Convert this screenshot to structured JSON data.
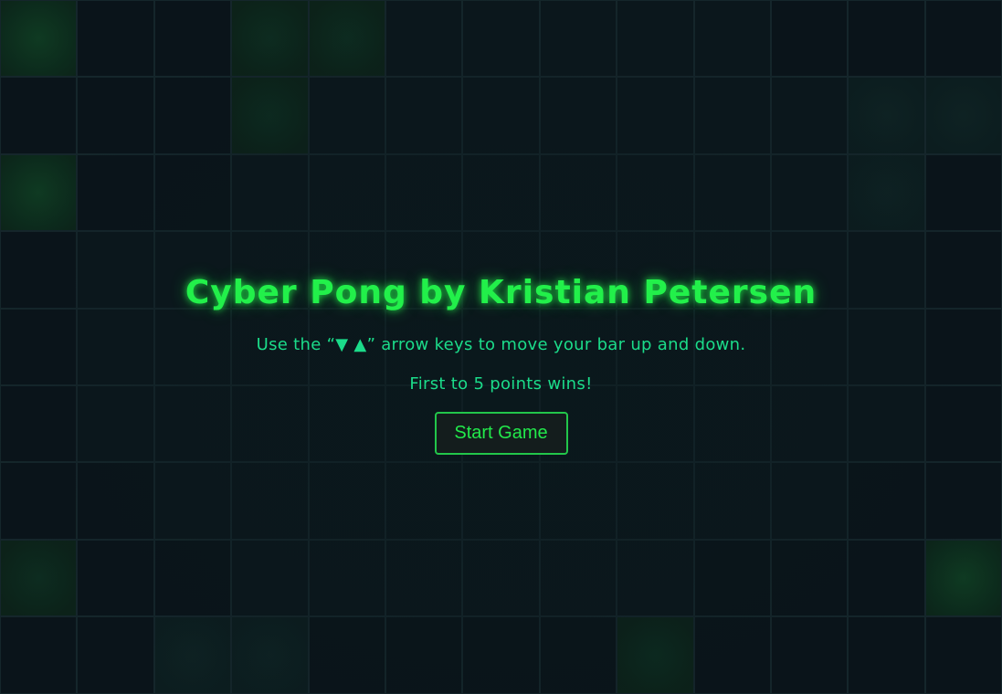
{
  "title": "Cyber Pong by Kristian Petersen",
  "instructions": {
    "prefix": "Use the “",
    "keys": "▼ ▲",
    "suffix": "” arrow keys to move your bar up and down."
  },
  "goal": "First to 5 points wins!",
  "start_button": "Start Game",
  "colors": {
    "title": "#22f04a",
    "text": "#1bdc8a",
    "button_border": "#22c64a",
    "background": "#0b161b"
  }
}
